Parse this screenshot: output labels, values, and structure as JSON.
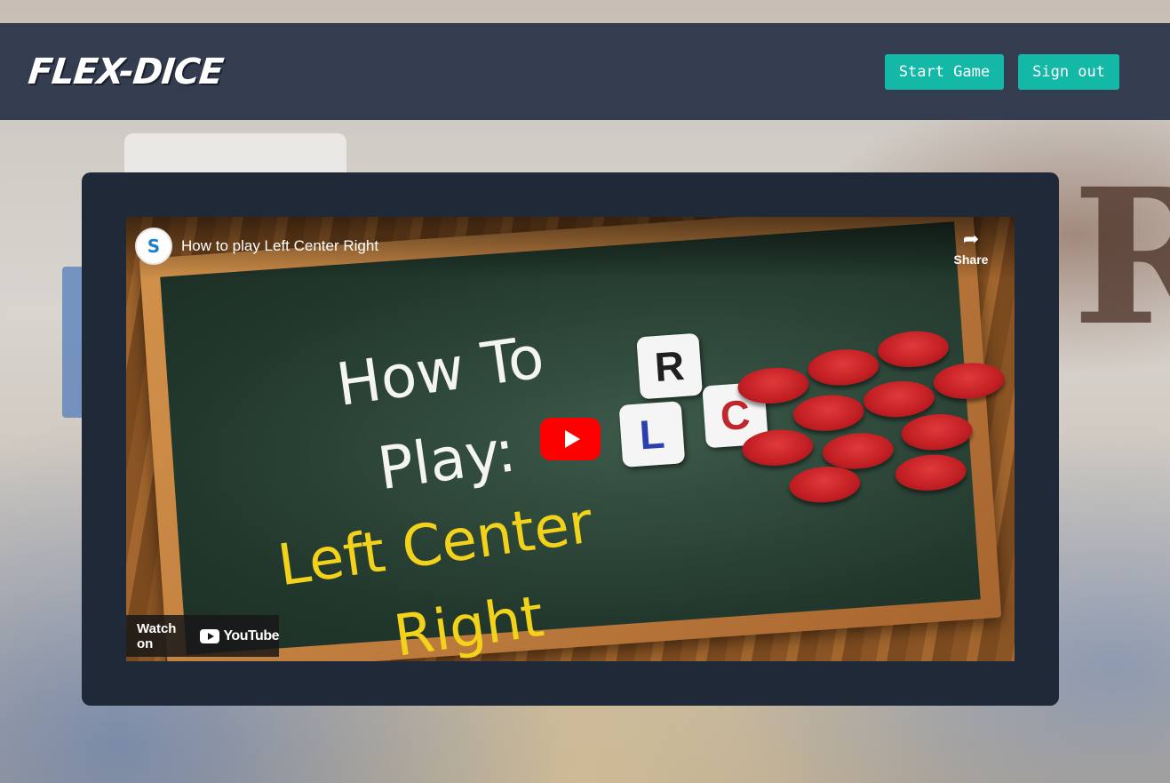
{
  "app": {
    "logo": "FLEX-DICE"
  },
  "nav": {
    "start_game": "Start Game",
    "sign_out": "Sign out"
  },
  "background": {
    "letter": "R"
  },
  "video": {
    "channel_initial": "S",
    "title": "How to play Left Center Right",
    "share_label": "Share",
    "thumbnail_lines": [
      "How To",
      "Play:",
      "Left Center",
      "Right"
    ],
    "dice": [
      "R",
      "L",
      "C"
    ],
    "watch_on": "Watch on",
    "youtube_brand": "YouTube"
  },
  "colors": {
    "accent": "#14b8a6",
    "navbar": "#343d4f",
    "card": "#1f2937",
    "play_button": "#ff0000"
  }
}
